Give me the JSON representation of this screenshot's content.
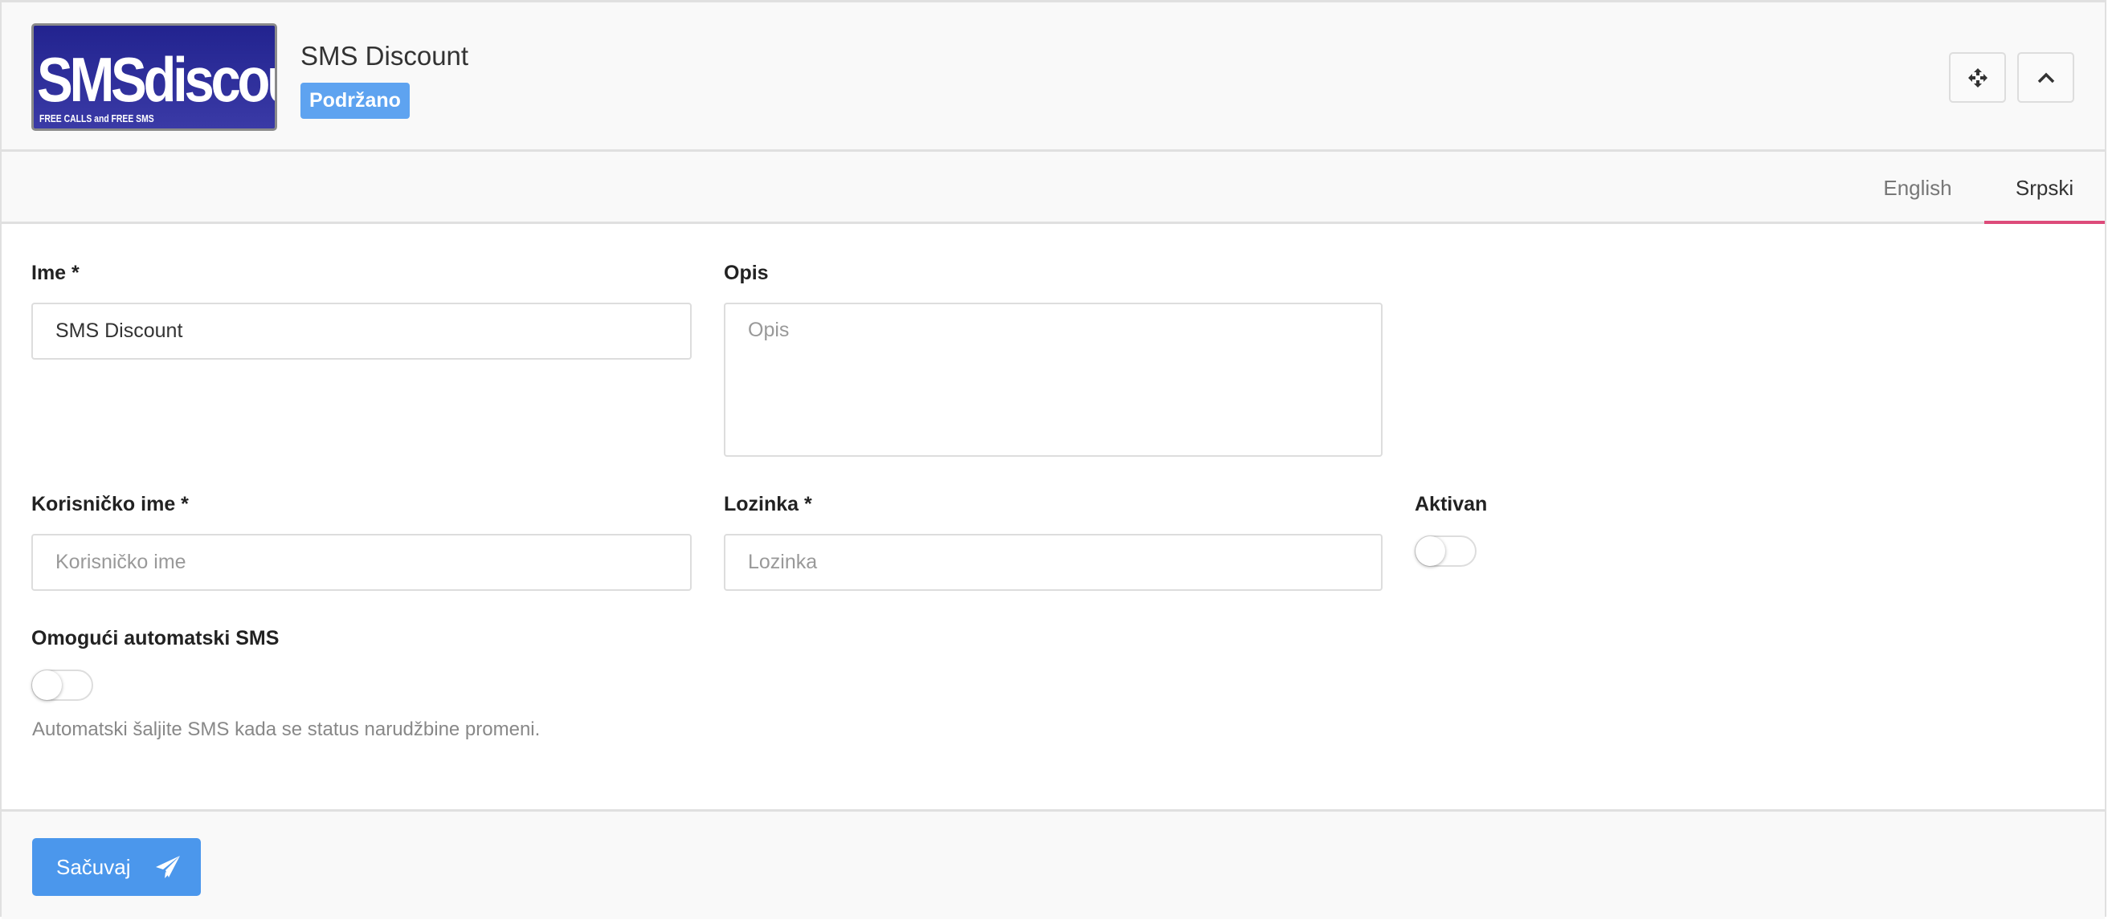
{
  "header": {
    "logo_text": "SMSdiscount",
    "logo_tagline": "FREE CALLS and FREE SMS",
    "title": "SMS Discount",
    "badge": "Podržano",
    "move_icon": "arrows-move-icon",
    "collapse_icon": "chevron-up-icon"
  },
  "tabs": [
    {
      "label": "English",
      "active": false
    },
    {
      "label": "Srpski",
      "active": true
    }
  ],
  "form": {
    "name": {
      "label": "Ime *",
      "value": "SMS Discount"
    },
    "description": {
      "label": "Opis",
      "placeholder": "Opis",
      "value": ""
    },
    "username": {
      "label": "Korisničko ime *",
      "placeholder": "Korisničko ime",
      "value": ""
    },
    "password": {
      "label": "Lozinka *",
      "placeholder": "Lozinka",
      "value": ""
    },
    "active": {
      "label": "Aktivan",
      "checked": false
    },
    "auto_sms": {
      "label": "Omogući automatski SMS",
      "checked": false,
      "help": "Automatski šaljite SMS kada se status narudžbine promeni."
    }
  },
  "footer": {
    "save_label": "Sačuvaj",
    "save_icon": "paper-plane-icon"
  },
  "colors": {
    "accent": "#4b97ec",
    "badge": "#5ea3f0",
    "tab_underline": "#dd4b7a"
  }
}
